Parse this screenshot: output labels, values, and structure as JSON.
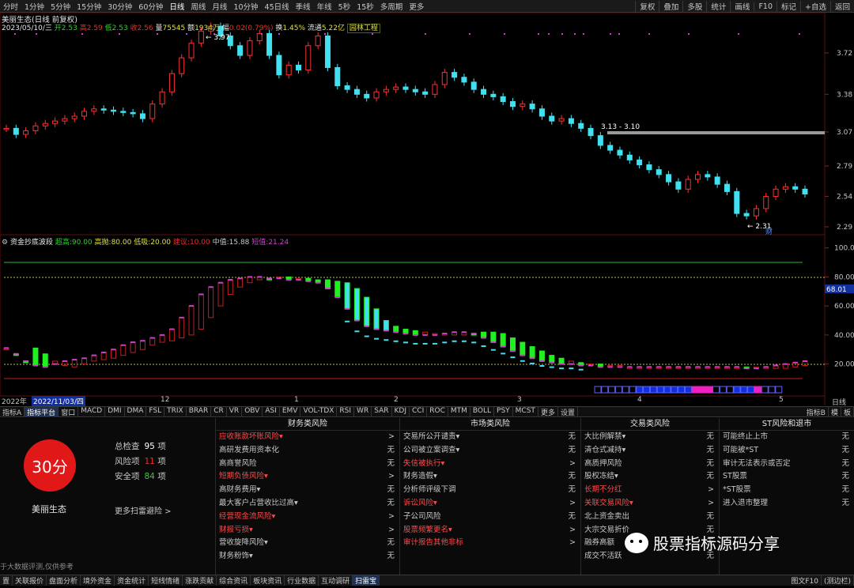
{
  "topbar": {
    "periods": [
      "分时",
      "1分钟",
      "5分钟",
      "15分钟",
      "30分钟",
      "60分钟",
      "日线",
      "周线",
      "月线",
      "10分钟",
      "45日线",
      "季线",
      "年线",
      "5秒",
      "15秒",
      "多周期",
      "更多"
    ],
    "active_period": "日线",
    "right": [
      "复权",
      "叠加",
      "多股",
      "统计",
      "画线",
      "F10",
      "标记",
      "+自选",
      "返回"
    ]
  },
  "info": {
    "title": "美丽生态(日线 前复权)",
    "date": "2023/05/10/三",
    "open_label": "开",
    "open": "2.53",
    "high_label": "高",
    "high": "2.59",
    "low_label": "低",
    "low": "2.53",
    "close_label": "收",
    "close": "2.56",
    "vol_label": "量",
    "vol": "75545",
    "amount_label": "额",
    "amount": "1934万",
    "change_label": "幅",
    "change": "0.02(0.79%)",
    "turnover_label": "换",
    "turnover": "1.45%",
    "float_label": "流通",
    "float": "5.22亿",
    "sector": "园林工程"
  },
  "price_axis": [
    "3.72",
    "3.38",
    "3.07",
    "2.79",
    "2.54",
    "2.29"
  ],
  "annotations": {
    "high": "3.97",
    "low": "2.31",
    "resist": "3.13 - 3.10",
    "cai": "财"
  },
  "indicator": {
    "name": "资金抄底波段",
    "l1_label": "超高:",
    "l1": "90.00",
    "l2_label": "高抛:",
    "l2": "80.00",
    "l3_label": "低吸:",
    "l3": "20.00",
    "l4_label": "建议:",
    "l4": "10.00",
    "l5_label": "中值:",
    "l5": "15.88",
    "l6_label": "短值:",
    "l6": "21.24",
    "axis": [
      "100.00",
      "80.00",
      "60.00",
      "40.00",
      "20.00"
    ],
    "current": "68.01"
  },
  "timeline": {
    "start": "2022年",
    "cursor": "2022/11/03/四",
    "months": [
      "12",
      "1",
      "2",
      "3",
      "4",
      "5"
    ],
    "right": "日线"
  },
  "indbar": {
    "items": [
      "指标A",
      "指标平台",
      "窗口",
      "MACD",
      "DMI",
      "DMA",
      "FSL",
      "TRIX",
      "BRAR",
      "CR",
      "VR",
      "OBV",
      "ASI",
      "EMV",
      "VOL-TDX",
      "RSI",
      "WR",
      "SAR",
      "KDJ",
      "CCI",
      "ROC",
      "MTM",
      "BOLL",
      "PSY",
      "MCST",
      "更多",
      "设置"
    ],
    "right": [
      "指标B",
      "模",
      "板"
    ]
  },
  "panel": {
    "score": "30分",
    "name": "美丽生态",
    "total_label": "总检查",
    "total": "95",
    "unit": "项",
    "risk_label": "风险项",
    "risk": "11",
    "safe_label": "安全项",
    "safe": "84",
    "more": "更多扫雷避险 >",
    "note": "于大数据评测,仅供参考",
    "columns": [
      {
        "title": "财务类风险",
        "rows": [
          {
            "t": "应收账款坏账风险▾",
            "s": ">",
            "r": true
          },
          {
            "t": "高研发费用资本化",
            "s": "无",
            "r": false
          },
          {
            "t": "高商誉风险",
            "s": "无",
            "r": false
          },
          {
            "t": "短期负债风险▾",
            "s": ">",
            "r": true
          },
          {
            "t": "高财务费用▾",
            "s": "无",
            "r": false
          },
          {
            "t": "最大客户占营收比过高▾",
            "s": "无",
            "r": false
          },
          {
            "t": "经营现金流风险▾",
            "s": ">",
            "r": true
          },
          {
            "t": "财报亏损▾",
            "s": ">",
            "r": true
          },
          {
            "t": "营收旋降风险▾",
            "s": "无",
            "r": false
          },
          {
            "t": "财务粉饰▾",
            "s": "无",
            "r": false
          }
        ]
      },
      {
        "title": "市场类风险",
        "rows": [
          {
            "t": "交易所公开谴责▾",
            "s": "无",
            "r": false
          },
          {
            "t": "公司被立案调查▾",
            "s": "无",
            "r": false
          },
          {
            "t": "失信被执行▾",
            "s": ">",
            "r": true
          },
          {
            "t": "财务造假▾",
            "s": "无",
            "r": false
          },
          {
            "t": "分析师评级下调",
            "s": "无",
            "r": false
          },
          {
            "t": "诉讼风险▾",
            "s": ">",
            "r": true
          },
          {
            "t": "子公司风险",
            "s": "无",
            "r": false
          },
          {
            "t": "股票频繁更名▾",
            "s": ">",
            "r": true
          },
          {
            "t": "审计报告其他非标",
            "s": ">",
            "r": true
          }
        ]
      },
      {
        "title": "交易类风险",
        "rows": [
          {
            "t": "大比例解禁▾",
            "s": "无",
            "r": false
          },
          {
            "t": "清仓式减持▾",
            "s": "无",
            "r": false
          },
          {
            "t": "高质押风险",
            "s": "无",
            "r": false
          },
          {
            "t": "股权冻结▾",
            "s": "无",
            "r": false
          },
          {
            "t": "长期不分红",
            "s": ">",
            "r": true
          },
          {
            "t": "关联交易风险▾",
            "s": ">",
            "r": true
          },
          {
            "t": "北上资金卖出",
            "s": "无",
            "r": false
          },
          {
            "t": "大宗交易折价",
            "s": "无",
            "r": false
          },
          {
            "t": "融券高额",
            "s": "无",
            "r": false
          },
          {
            "t": "成交不活跃",
            "s": "无",
            "r": false
          }
        ]
      },
      {
        "title": "ST风险和退市",
        "rows": [
          {
            "t": "可能终止上市",
            "s": "无",
            "r": false
          },
          {
            "t": "可能被*ST",
            "s": "无",
            "r": false
          },
          {
            "t": "审计无法表示或否定",
            "s": "无",
            "r": false
          },
          {
            "t": "ST股票",
            "s": "无",
            "r": false
          },
          {
            "t": "*ST股票",
            "s": "无",
            "r": false
          },
          {
            "t": "进入退市整理",
            "s": "无",
            "r": false
          }
        ]
      }
    ]
  },
  "watermark": "股票指标源码分享",
  "bottombar": {
    "items": [
      "置",
      "关联报价",
      "盘面分析",
      "境外资金",
      "资金统计",
      "短线情绪",
      "涨跌贡献",
      "综合资讯",
      "板块资讯",
      "行业数据",
      "互动调研",
      "扫雷宝"
    ],
    "active": "扫雷宝",
    "right": [
      "图文F10",
      "(测边栏)"
    ]
  },
  "chart_data": {
    "type": "candlestick",
    "close": [
      3.1,
      3.05,
      3.08,
      3.12,
      3.14,
      3.16,
      3.18,
      3.2,
      3.24,
      3.26,
      3.25,
      3.24,
      3.23,
      3.22,
      3.18,
      3.3,
      3.4,
      3.55,
      3.68,
      3.8,
      3.9,
      3.94,
      3.86,
      3.78,
      3.7,
      3.82,
      3.88,
      3.7,
      3.54,
      3.62,
      3.58,
      3.78,
      3.86,
      3.6,
      3.45,
      3.42,
      3.38,
      3.35,
      3.4,
      3.42,
      3.44,
      3.42,
      3.4,
      3.38,
      3.46,
      3.56,
      3.52,
      3.48,
      3.42,
      3.38,
      3.36,
      3.32,
      3.28,
      3.3,
      3.26,
      3.2,
      3.16,
      3.18,
      3.14,
      3.1,
      3.04,
      2.96,
      2.92,
      2.88,
      2.84,
      2.8,
      2.76,
      2.72,
      2.66,
      2.6,
      2.68,
      2.72,
      2.7,
      2.64,
      2.58,
      2.4,
      2.38,
      2.44,
      2.54,
      2.6,
      2.62,
      2.6,
      2.56
    ],
    "indicator_purple": [
      31,
      27,
      22,
      19,
      18,
      20,
      22,
      23,
      24,
      26,
      28,
      30,
      33,
      35,
      36,
      38,
      40,
      44,
      52,
      60,
      68,
      73,
      76,
      78,
      79,
      80,
      80,
      79,
      79,
      78,
      78,
      77,
      76,
      72,
      66,
      58,
      50,
      46,
      44,
      43,
      42,
      41,
      40,
      40,
      40,
      41,
      42,
      42,
      41,
      38,
      35,
      32,
      29,
      26,
      24,
      22,
      21,
      20,
      20,
      19,
      19,
      18,
      18,
      18,
      18,
      18,
      18,
      18,
      18,
      18,
      18,
      18,
      18,
      18,
      18,
      18,
      17,
      17,
      18,
      19,
      20,
      21,
      22
    ]
  }
}
